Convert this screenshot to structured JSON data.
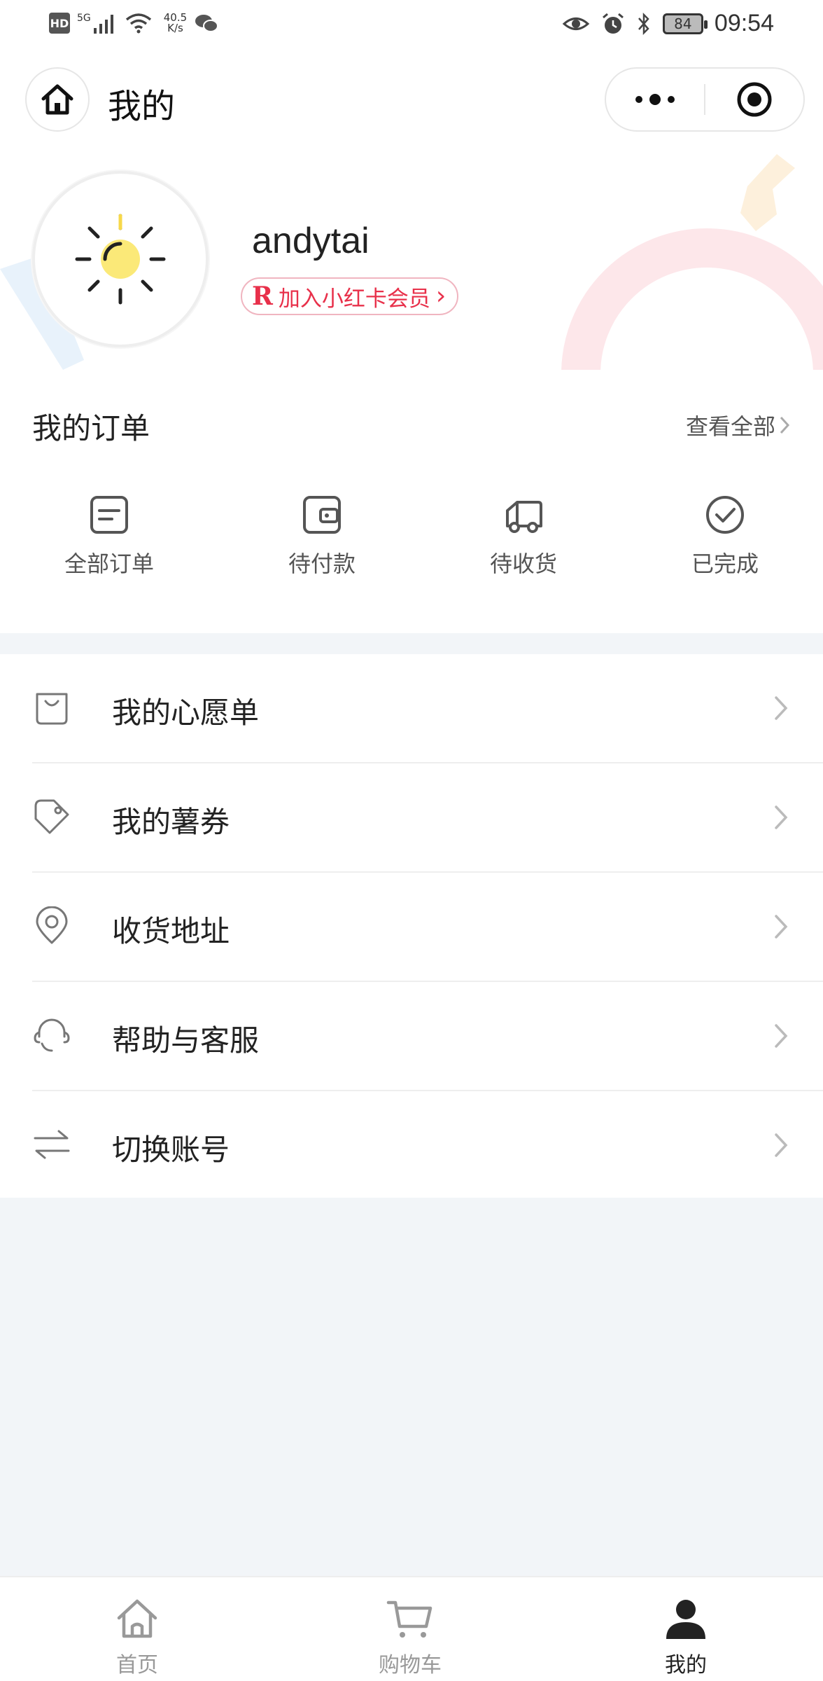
{
  "status_bar": {
    "hd_badge": "HD",
    "network_type": "5G",
    "net_speed_value": "40.5",
    "net_speed_unit": "K/s",
    "battery": "84",
    "time": "09:54"
  },
  "title_bar": {
    "title": "我的"
  },
  "profile": {
    "username": "andytai",
    "vip_badge_letter": "R",
    "vip_label": "加入小红卡会员",
    "vip_arrow": "›"
  },
  "orders": {
    "title": "我的订单",
    "view_all": "查看全部",
    "items": [
      {
        "label": "全部订单",
        "icon": "order-list-icon"
      },
      {
        "label": "待付款",
        "icon": "wallet-icon"
      },
      {
        "label": "待收货",
        "icon": "truck-icon"
      },
      {
        "label": "已完成",
        "icon": "check-circle-icon"
      }
    ]
  },
  "menu": [
    {
      "label": "我的心愿单",
      "icon": "bag-icon"
    },
    {
      "label": "我的薯券",
      "icon": "tag-icon"
    },
    {
      "label": "收货地址",
      "icon": "location-pin-icon"
    },
    {
      "label": "帮助与客服",
      "icon": "headset-icon"
    },
    {
      "label": "切换账号",
      "icon": "switch-arrows-icon"
    }
  ],
  "tab_bar": {
    "active": "我的",
    "tabs": [
      {
        "label": "首页",
        "icon": "home-icon"
      },
      {
        "label": "购物车",
        "icon": "cart-icon"
      },
      {
        "label": "我的",
        "icon": "user-icon"
      }
    ]
  },
  "colors": {
    "accent_red": "#e8304a",
    "page_bg": "#f2f5f8",
    "text_primary": "#222222",
    "text_secondary": "#555555",
    "tab_inactive": "#999999"
  }
}
